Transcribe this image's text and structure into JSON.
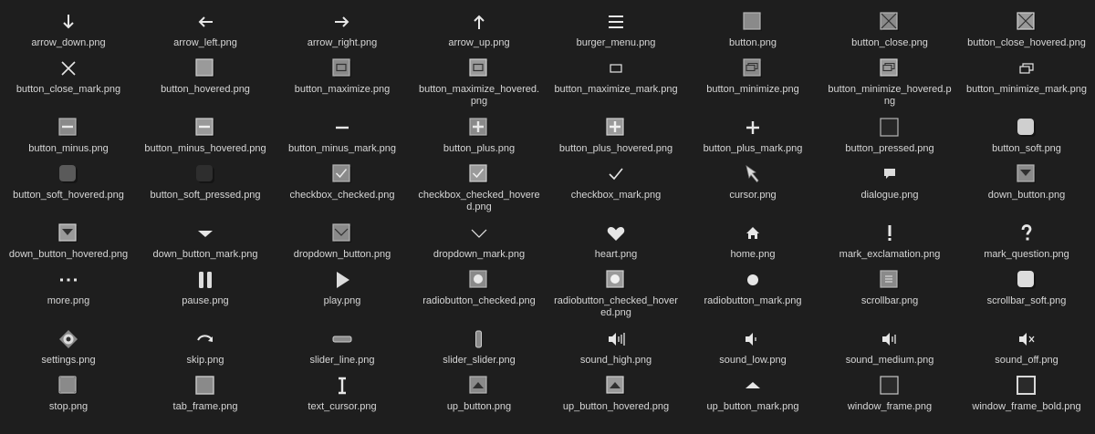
{
  "files": [
    {
      "name": "arrow_down.png",
      "icon": "arrow-down-icon"
    },
    {
      "name": "arrow_left.png",
      "icon": "arrow-left-icon"
    },
    {
      "name": "arrow_right.png",
      "icon": "arrow-right-icon"
    },
    {
      "name": "arrow_up.png",
      "icon": "arrow-up-icon"
    },
    {
      "name": "burger_menu.png",
      "icon": "burger-menu-icon"
    },
    {
      "name": "button.png",
      "icon": "button-icon"
    },
    {
      "name": "button_close.png",
      "icon": "button-close-icon"
    },
    {
      "name": "button_close_hovered.png",
      "icon": "button-close-hovered-icon"
    },
    {
      "name": "button_close_mark.png",
      "icon": "close-mark-icon"
    },
    {
      "name": "button_hovered.png",
      "icon": "button-hovered-icon"
    },
    {
      "name": "button_maximize.png",
      "icon": "button-maximize-icon"
    },
    {
      "name": "button_maximize_hovered.png",
      "icon": "button-maximize-hovered-icon"
    },
    {
      "name": "button_maximize_mark.png",
      "icon": "maximize-mark-icon"
    },
    {
      "name": "button_minimize.png",
      "icon": "button-minimize-icon"
    },
    {
      "name": "button_minimize_hovered.png",
      "icon": "button-minimize-hovered-icon"
    },
    {
      "name": "button_minimize_mark.png",
      "icon": "minimize-mark-icon"
    },
    {
      "name": "button_minus.png",
      "icon": "button-minus-icon"
    },
    {
      "name": "button_minus_hovered.png",
      "icon": "button-minus-hovered-icon"
    },
    {
      "name": "button_minus_mark.png",
      "icon": "minus-mark-icon"
    },
    {
      "name": "button_plus.png",
      "icon": "button-plus-icon"
    },
    {
      "name": "button_plus_hovered.png",
      "icon": "button-plus-hovered-icon"
    },
    {
      "name": "button_plus_mark.png",
      "icon": "plus-mark-icon"
    },
    {
      "name": "button_pressed.png",
      "icon": "button-pressed-icon"
    },
    {
      "name": "button_soft.png",
      "icon": "button-soft-icon"
    },
    {
      "name": "button_soft_hovered.png",
      "icon": "button-soft-hovered-icon"
    },
    {
      "name": "button_soft_pressed.png",
      "icon": "button-soft-pressed-icon"
    },
    {
      "name": "checkbox_checked.png",
      "icon": "checkbox-checked-icon"
    },
    {
      "name": "checkbox_checked_hovered.png",
      "icon": "checkbox-checked-hovered-icon"
    },
    {
      "name": "checkbox_mark.png",
      "icon": "checkbox-mark-icon"
    },
    {
      "name": "cursor.png",
      "icon": "cursor-icon"
    },
    {
      "name": "dialogue.png",
      "icon": "dialogue-icon"
    },
    {
      "name": "down_button.png",
      "icon": "down-button-icon"
    },
    {
      "name": "down_button_hovered.png",
      "icon": "down-button-hovered-icon"
    },
    {
      "name": "down_button_mark.png",
      "icon": "down-button-mark-icon"
    },
    {
      "name": "dropdown_button.png",
      "icon": "dropdown-button-icon"
    },
    {
      "name": "dropdown_mark.png",
      "icon": "dropdown-mark-icon"
    },
    {
      "name": "heart.png",
      "icon": "heart-icon"
    },
    {
      "name": "home.png",
      "icon": "home-icon"
    },
    {
      "name": "mark_exclamation.png",
      "icon": "exclamation-icon"
    },
    {
      "name": "mark_question.png",
      "icon": "question-icon"
    },
    {
      "name": "more.png",
      "icon": "more-icon"
    },
    {
      "name": "pause.png",
      "icon": "pause-icon"
    },
    {
      "name": "play.png",
      "icon": "play-icon"
    },
    {
      "name": "radiobutton_checked.png",
      "icon": "radiobutton-checked-icon"
    },
    {
      "name": "radiobutton_checked_hovered.png",
      "icon": "radiobutton-checked-hovered-icon"
    },
    {
      "name": "radiobutton_mark.png",
      "icon": "radiobutton-mark-icon"
    },
    {
      "name": "scrollbar.png",
      "icon": "scrollbar-icon"
    },
    {
      "name": "scrollbar_soft.png",
      "icon": "scrollbar-soft-icon"
    },
    {
      "name": "settings.png",
      "icon": "settings-icon"
    },
    {
      "name": "skip.png",
      "icon": "skip-icon"
    },
    {
      "name": "slider_line.png",
      "icon": "slider-line-icon"
    },
    {
      "name": "slider_slider.png",
      "icon": "slider-handle-icon"
    },
    {
      "name": "sound_high.png",
      "icon": "sound-high-icon"
    },
    {
      "name": "sound_low.png",
      "icon": "sound-low-icon"
    },
    {
      "name": "sound_medium.png",
      "icon": "sound-medium-icon"
    },
    {
      "name": "sound_off.png",
      "icon": "sound-off-icon"
    },
    {
      "name": "stop.png",
      "icon": "stop-icon"
    },
    {
      "name": "tab_frame.png",
      "icon": "tab-frame-icon"
    },
    {
      "name": "text_cursor.png",
      "icon": "text-cursor-icon"
    },
    {
      "name": "up_button.png",
      "icon": "up-button-icon"
    },
    {
      "name": "up_button_hovered.png",
      "icon": "up-button-hovered-icon"
    },
    {
      "name": "up_button_mark.png",
      "icon": "up-button-mark-icon"
    },
    {
      "name": "window_frame.png",
      "icon": "window-frame-icon"
    },
    {
      "name": "window_frame_bold.png",
      "icon": "window-frame-bold-icon"
    }
  ]
}
